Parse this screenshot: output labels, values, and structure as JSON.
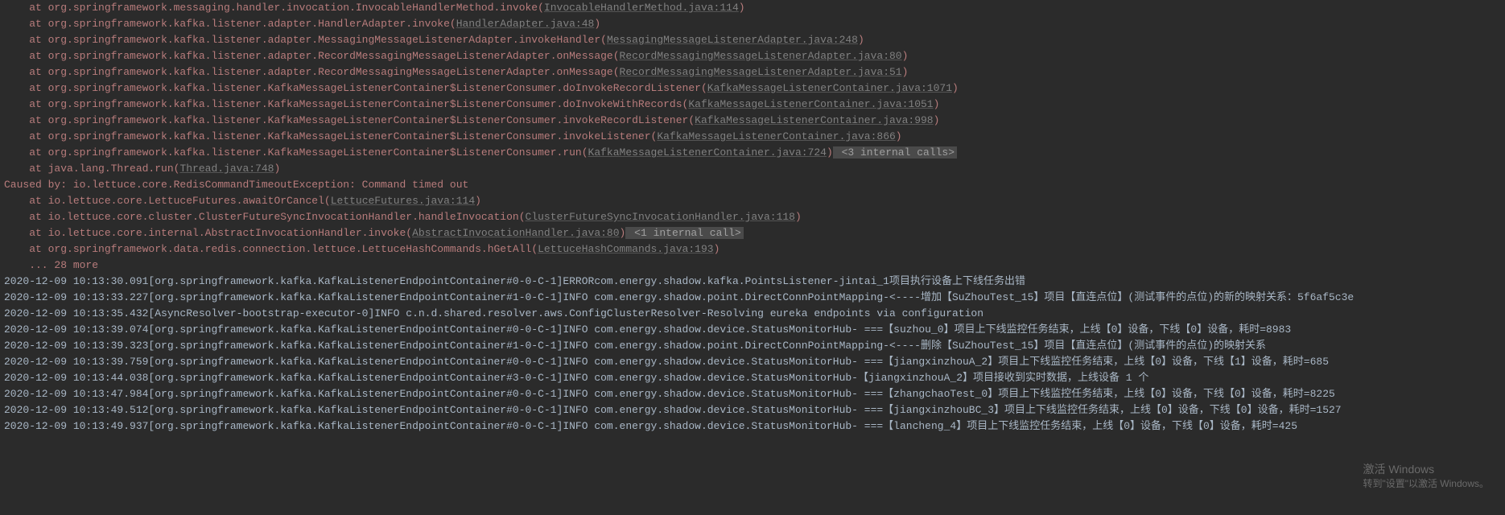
{
  "stacktrace": [
    {
      "indent": "    ",
      "prefix": "at ",
      "method": "org.springframework.messaging.handler.invocation.InvocableHandlerMethod.invoke",
      "location": "InvocableHandlerMethod.java:114"
    },
    {
      "indent": "    ",
      "prefix": "at ",
      "method": "org.springframework.kafka.listener.adapter.HandlerAdapter.invoke",
      "location": "HandlerAdapter.java:48"
    },
    {
      "indent": "    ",
      "prefix": "at ",
      "method": "org.springframework.kafka.listener.adapter.MessagingMessageListenerAdapter.invokeHandler",
      "location": "MessagingMessageListenerAdapter.java:248"
    },
    {
      "indent": "    ",
      "prefix": "at ",
      "method": "org.springframework.kafka.listener.adapter.RecordMessagingMessageListenerAdapter.onMessage",
      "location": "RecordMessagingMessageListenerAdapter.java:80"
    },
    {
      "indent": "    ",
      "prefix": "at ",
      "method": "org.springframework.kafka.listener.adapter.RecordMessagingMessageListenerAdapter.onMessage",
      "location": "RecordMessagingMessageListenerAdapter.java:51"
    },
    {
      "indent": "    ",
      "prefix": "at ",
      "method": "org.springframework.kafka.listener.KafkaMessageListenerContainer$ListenerConsumer.doInvokeRecordListener",
      "location": "KafkaMessageListenerContainer.java:1071"
    },
    {
      "indent": "    ",
      "prefix": "at ",
      "method": "org.springframework.kafka.listener.KafkaMessageListenerContainer$ListenerConsumer.doInvokeWithRecords",
      "location": "KafkaMessageListenerContainer.java:1051"
    },
    {
      "indent": "    ",
      "prefix": "at ",
      "method": "org.springframework.kafka.listener.KafkaMessageListenerContainer$ListenerConsumer.invokeRecordListener",
      "location": "KafkaMessageListenerContainer.java:998"
    },
    {
      "indent": "    ",
      "prefix": "at ",
      "method": "org.springframework.kafka.listener.KafkaMessageListenerContainer$ListenerConsumer.invokeListener",
      "location": "KafkaMessageListenerContainer.java:866"
    },
    {
      "indent": "    ",
      "prefix": "at ",
      "method": "org.springframework.kafka.listener.KafkaMessageListenerContainer$ListenerConsumer.run",
      "location": "KafkaMessageListenerContainer.java:724",
      "badge": " <3 internal calls>"
    },
    {
      "indent": "    ",
      "prefix": "at ",
      "method": "java.lang.Thread.run",
      "location": "Thread.java:748"
    }
  ],
  "caused_by": "Caused by: io.lettuce.core.RedisCommandTimeoutException: Command timed out",
  "stacktrace2": [
    {
      "indent": "    ",
      "prefix": "at ",
      "method": "io.lettuce.core.LettuceFutures.awaitOrCancel",
      "location": "LettuceFutures.java:114"
    },
    {
      "indent": "    ",
      "prefix": "at ",
      "method": "io.lettuce.core.cluster.ClusterFutureSyncInvocationHandler.handleInvocation",
      "location": "ClusterFutureSyncInvocationHandler.java:118"
    },
    {
      "indent": "    ",
      "prefix": "at ",
      "method": "io.lettuce.core.internal.AbstractInvocationHandler.invoke",
      "location": "AbstractInvocationHandler.java:80",
      "badge": " <1 internal call>"
    },
    {
      "indent": "    ",
      "prefix": "at ",
      "method": "org.springframework.data.redis.connection.lettuce.LettuceHashCommands.hGetAll",
      "location": "LettuceHashCommands.java:193"
    }
  ],
  "more": "    ... 28 more",
  "logs": [
    "2020-12-09 10:13:30.091[org.springframework.kafka.KafkaListenerEndpointContainer#0-0-C-1]ERRORcom.energy.shadow.kafka.PointsListener-jintai_1项目执行设备上下线任务出错",
    "2020-12-09 10:13:33.227[org.springframework.kafka.KafkaListenerEndpointContainer#1-0-C-1]INFO com.energy.shadow.point.DirectConnPointMapping-<----增加【SuZhouTest_15】项目【直连点位】(测试事件的点位)的新的映射关系：5f6af5c3e",
    "2020-12-09 10:13:35.432[AsyncResolver-bootstrap-executor-0]INFO c.n.d.shared.resolver.aws.ConfigClusterResolver-Resolving eureka endpoints via configuration",
    "2020-12-09 10:13:39.074[org.springframework.kafka.KafkaListenerEndpointContainer#0-0-C-1]INFO com.energy.shadow.device.StatusMonitorHub- ===【suzhou_0】项目上下线监控任务结束，上线【0】设备，下线【0】设备，耗时=8983",
    "2020-12-09 10:13:39.323[org.springframework.kafka.KafkaListenerEndpointContainer#1-0-C-1]INFO com.energy.shadow.point.DirectConnPointMapping-<----删除【SuZhouTest_15】项目【直连点位】(测试事件的点位)的映射关系",
    "2020-12-09 10:13:39.759[org.springframework.kafka.KafkaListenerEndpointContainer#0-0-C-1]INFO com.energy.shadow.device.StatusMonitorHub- ===【jiangxinzhouA_2】项目上下线监控任务结束，上线【0】设备，下线【1】设备，耗时=685",
    "2020-12-09 10:13:44.038[org.springframework.kafka.KafkaListenerEndpointContainer#3-0-C-1]INFO com.energy.shadow.device.StatusMonitorHub-【jiangxinzhouA_2】项目接收到实时数据，上线设备 1 个",
    "2020-12-09 10:13:47.984[org.springframework.kafka.KafkaListenerEndpointContainer#0-0-C-1]INFO com.energy.shadow.device.StatusMonitorHub- ===【zhangchaoTest_0】项目上下线监控任务结束，上线【0】设备，下线【0】设备，耗时=8225",
    "2020-12-09 10:13:49.512[org.springframework.kafka.KafkaListenerEndpointContainer#0-0-C-1]INFO com.energy.shadow.device.StatusMonitorHub- ===【jiangxinzhouBC_3】项目上下线监控任务结束，上线【0】设备，下线【0】设备，耗时=1527",
    "2020-12-09 10:13:49.937[org.springframework.kafka.KafkaListenerEndpointContainer#0-0-C-1]INFO com.energy.shadow.device.StatusMonitorHub- ===【lancheng_4】项目上下线监控任务结束，上线【0】设备，下线【0】设备，耗时=425"
  ],
  "watermark": {
    "line1": "激活 Windows",
    "line2": "转到\"设置\"以激活 Windows。"
  }
}
